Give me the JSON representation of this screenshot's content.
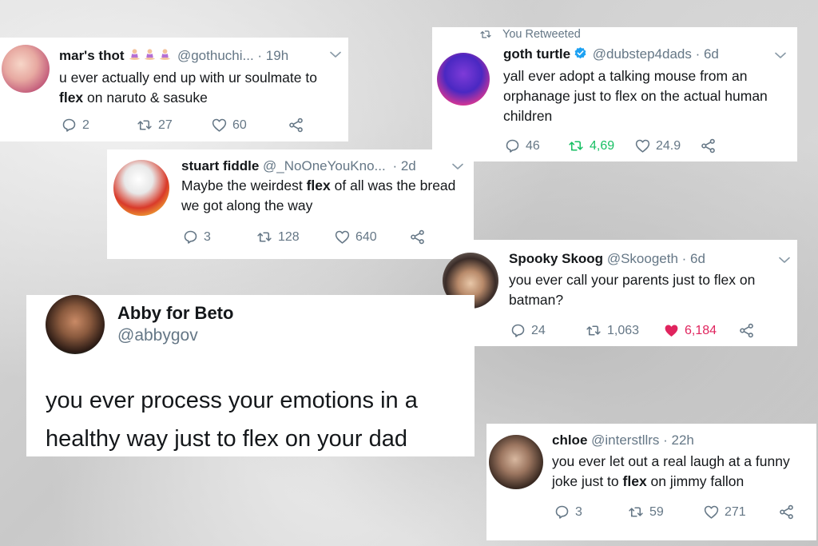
{
  "tweets": [
    {
      "name": "mar's thot",
      "handle": "@gothuchi...",
      "time": "· 19h",
      "text_pre": "u ever actually end up with ur soulmate to ",
      "text_bold": "flex",
      "text_post": " on naruto & sasuke",
      "replies": "2",
      "retweets": "27",
      "likes": "60"
    },
    {
      "retweet_label": "You Retweeted",
      "name": "goth turtle",
      "handle": "@dubstep4dads",
      "time": "· 6d",
      "text": "yall ever adopt a talking mouse from an orphanage just to flex on the actual human children",
      "replies": "46",
      "retweets": "4,69",
      "likes": "24.9",
      "retweet_color": "#17bf63"
    },
    {
      "name": "stuart fiddle",
      "handle": "@_NoOneYouKno...",
      "time": "· 2d",
      "text_pre": "Maybe the weirdest ",
      "text_bold": "flex",
      "text_post": " of all was the bread we got along the way",
      "replies": "3",
      "retweets": "128",
      "likes": "640"
    },
    {
      "name": "Spooky Skoog",
      "handle": "@Skoogeth",
      "time": "· 6d",
      "text": "you ever call your parents just to flex on batman?",
      "replies": "24",
      "retweets": "1,063",
      "likes": "6,184",
      "like_color": "#e0245e"
    },
    {
      "name": "Abby for Beto",
      "handle": "@abbygov",
      "text": "you ever process your emotions in a healthy way just to flex on your dad"
    },
    {
      "name": "chloe",
      "handle": "@interstllrs",
      "time": "· 22h",
      "text_pre": "you ever let out a real laugh at a funny joke just to ",
      "text_bold": "flex",
      "text_post": " on jimmy fallon",
      "replies": "3",
      "retweets": "59",
      "likes": "271"
    }
  ],
  "icon_color": "#657786",
  "verified_color": "#1da1f2"
}
